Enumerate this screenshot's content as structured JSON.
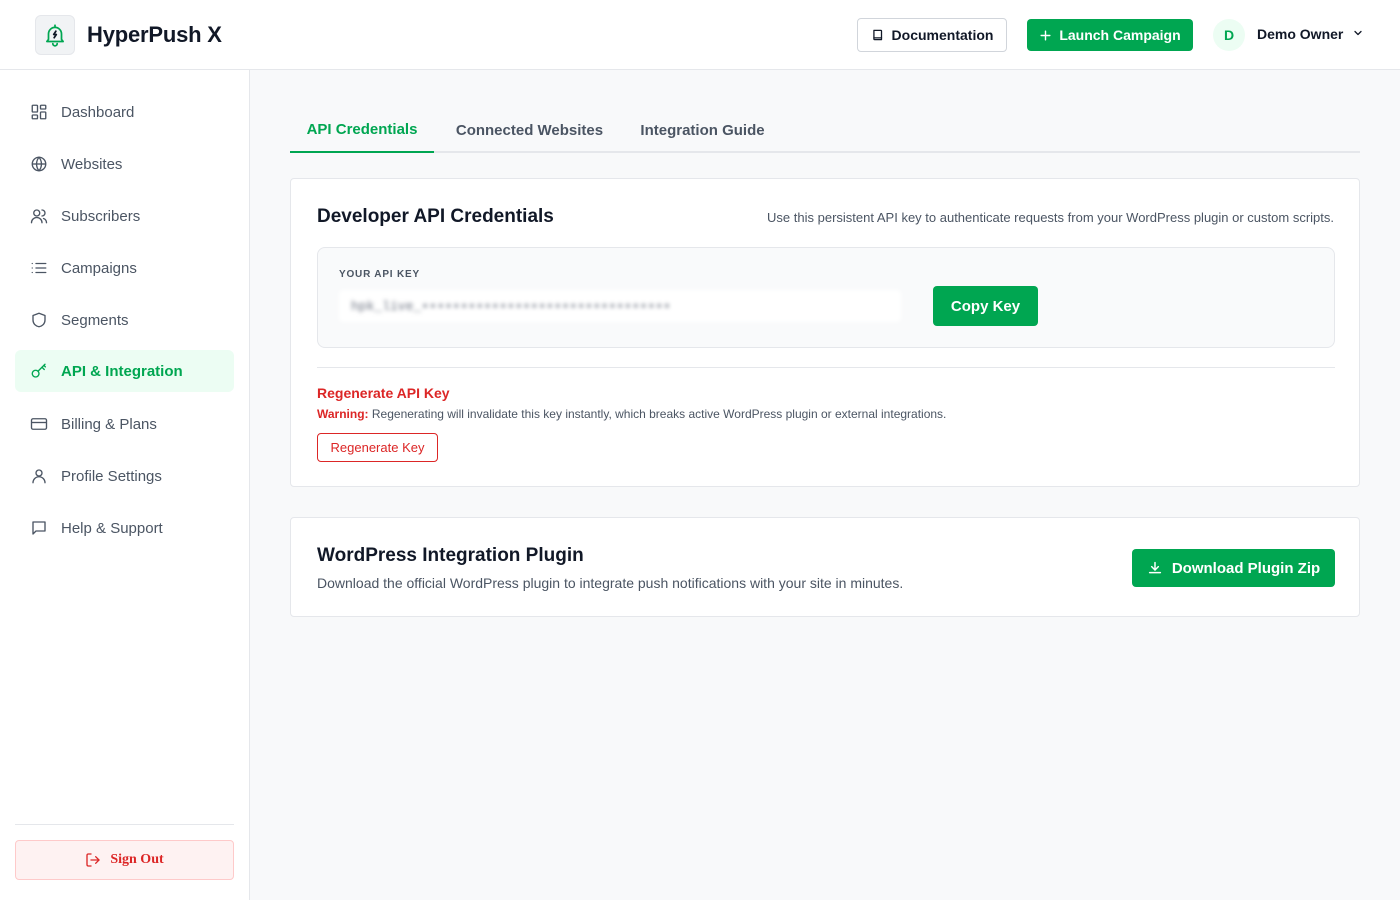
{
  "app": {
    "brand": "HyperPush X",
    "logo_icon": "bell-bolt-icon",
    "accent_color": "#00a651",
    "danger_color": "#dc2626"
  },
  "header": {
    "documentation_label": "Documentation",
    "launch_label": "Launch Campaign",
    "user_initial": "D",
    "user_name": "Demo Owner"
  },
  "sidebar": {
    "items": [
      {
        "label": "Dashboard",
        "icon": "dashboard-icon",
        "active": false
      },
      {
        "label": "Websites",
        "icon": "globe-icon",
        "active": false
      },
      {
        "label": "Subscribers",
        "icon": "users-icon",
        "active": false
      },
      {
        "label": "Campaigns",
        "icon": "list-icon",
        "active": false
      },
      {
        "label": "Segments",
        "icon": "shield-icon",
        "active": false
      },
      {
        "label": "API & Integration",
        "icon": "key-icon",
        "active": true
      },
      {
        "label": "Billing & Plans",
        "icon": "credit-card-icon",
        "active": false
      },
      {
        "label": "Profile Settings",
        "icon": "user-icon",
        "active": false
      },
      {
        "label": "Help & Support",
        "icon": "message-icon",
        "active": false
      }
    ],
    "signout_label": "Sign Out"
  },
  "tabs": [
    {
      "label": "API Credentials",
      "active": true
    },
    {
      "label": "Connected Websites",
      "active": false
    },
    {
      "label": "Integration Guide",
      "active": false
    }
  ],
  "credentials": {
    "title": "Developer API Credentials",
    "description": "Use this persistent API key to authenticate requests from your WordPress plugin or custom scripts.",
    "key_label": "YOUR API KEY",
    "key_value": "hpk_live_••••••••••••••••••••••••••••••••",
    "copy_label": "Copy Key",
    "regen_title": "Regenerate API Key",
    "warning_prefix": "Warning:",
    "warning_text": " Regenerating will invalidate this key instantly, which breaks active WordPress plugin or external integrations.",
    "regen_button": "Regenerate Key"
  },
  "plugin": {
    "title": "WordPress Integration Plugin",
    "description": "Download the official WordPress plugin to integrate push notifications with your site in minutes.",
    "download_label": "Download Plugin Zip"
  }
}
